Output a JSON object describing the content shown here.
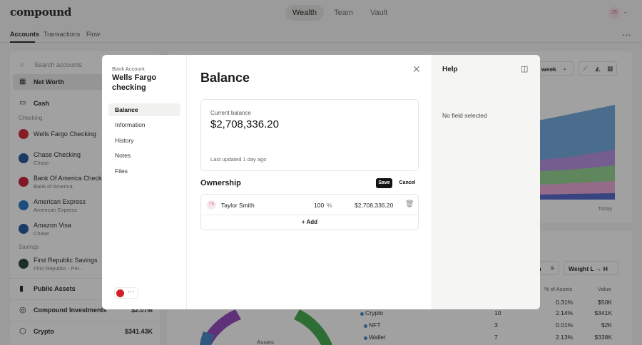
{
  "app": {
    "logo": "compound",
    "user_initials": "JS"
  },
  "topnav": {
    "tabs": [
      "Wealth",
      "Team",
      "Vault"
    ],
    "active": "Wealth"
  },
  "subnav": {
    "tabs": [
      "Accounts",
      "Transactions",
      "Flow"
    ],
    "active": "Accounts"
  },
  "sidebar": {
    "search_placeholder": "Search accounts",
    "net_worth": "Net Worth",
    "cash": "Cash",
    "checking_label": "Checking",
    "savings_label": "Savings",
    "checking": [
      {
        "name": "Wells Fargo Checking",
        "sub": "",
        "color": "#d1202a"
      },
      {
        "name": "Chase Checking",
        "sub": "Chase",
        "color": "#1a4f9c"
      },
      {
        "name": "Bank Of America Checking",
        "sub": "Bank of America",
        "color": "#c8102e"
      },
      {
        "name": "American Express",
        "sub": "American Express",
        "color": "#1d6ec3"
      },
      {
        "name": "Amazon Visa",
        "sub": "Chase",
        "color": "#1a4f9c"
      }
    ],
    "savings": [
      {
        "name": "First Republic Savings",
        "sub": "First Republic - Per...",
        "color": "#1b3a2b"
      }
    ],
    "groups": [
      {
        "label": "Public Assets",
        "value": "",
        "icon": "bar-chart-icon"
      },
      {
        "label": "Compound Investments",
        "value": "$2.07M",
        "icon": "compound-icon"
      },
      {
        "label": "Crypto",
        "value": "$341.43K",
        "icon": "crypto-icon"
      }
    ]
  },
  "chart_controls": {
    "range": "week",
    "today_label": "Today"
  },
  "holdings_controls": {
    "sort_label": "m",
    "weight_label": "Weight L → H"
  },
  "holdings_table": {
    "headers": {
      "pct": "% of Assets",
      "value": "Value"
    },
    "top_row": {
      "pct": "0.31%",
      "value": "$50K"
    },
    "rows": [
      {
        "name": "Crypto",
        "count": "10",
        "pct": "2.14%",
        "value": "$341K"
      },
      {
        "name": "NFT",
        "count": "3",
        "pct": "0.01%",
        "value": "$2K"
      },
      {
        "name": "Wallet",
        "count": "7",
        "pct": "2.13%",
        "value": "$338K"
      }
    ],
    "donut_label": "Assets"
  },
  "modal": {
    "kicker": "Bank Account",
    "account_name": "Wells Fargo checking",
    "nav": [
      "Balance",
      "Information",
      "History",
      "Notes",
      "Files"
    ],
    "active_nav": "Balance",
    "title": "Balance",
    "balance": {
      "label": "Current balance",
      "value": "$2,708,336.20",
      "updated": "Last updated 1 day ago"
    },
    "ownership": {
      "title": "Ownership",
      "save_label": "Save",
      "cancel_label": "Cancel",
      "owner_initials": "TS",
      "owner_name": "Taylor Smith",
      "percent": "100",
      "percent_unit": "%",
      "amount": "$2,708,336.20",
      "add_label": "+ Add"
    },
    "help": {
      "title": "Help",
      "empty": "No field selected"
    }
  },
  "colors": {
    "accent": "#1c1c1c",
    "chart_blue": "#6ca6dd",
    "chart_purple": "#b18be0",
    "chart_green": "#8fd08a",
    "chart_pink": "#e8a3d6",
    "donut_green": "#3aa845",
    "donut_purple": "#8e3eb8"
  }
}
